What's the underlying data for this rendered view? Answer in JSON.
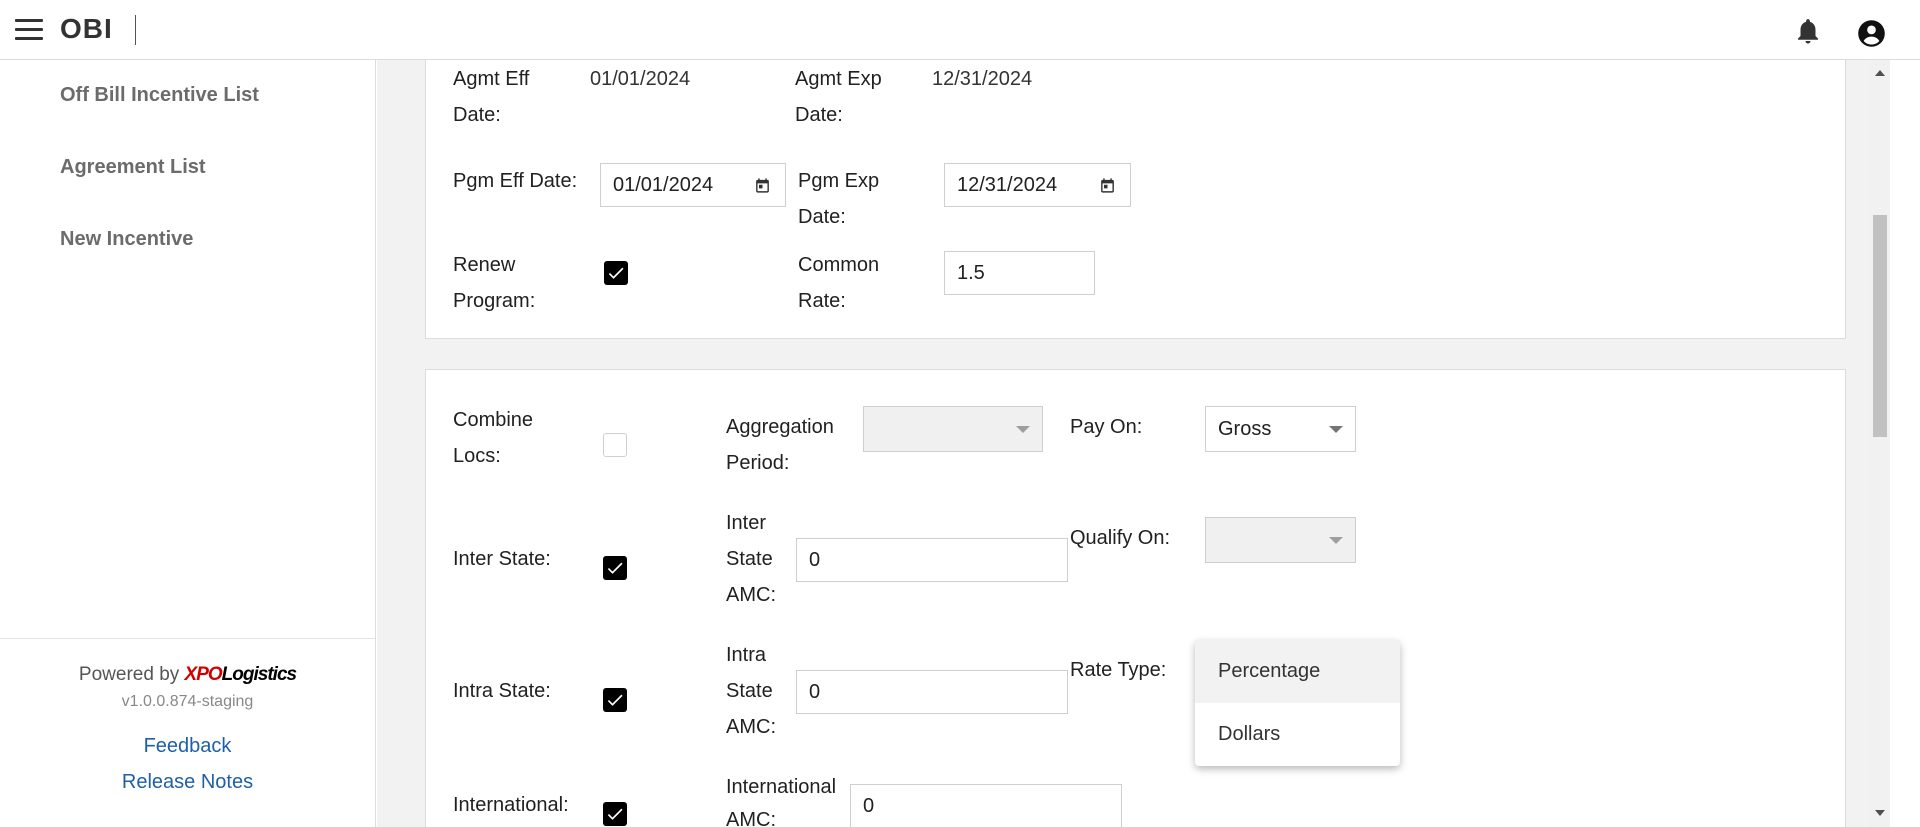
{
  "app": {
    "title": "OBI"
  },
  "icons": {
    "menu": "menu-icon",
    "bell": "bell-icon",
    "account": "account-circle-icon",
    "calendar": "calendar-icon",
    "check": "check-icon",
    "caret": "caret-down-icon"
  },
  "sidebar": {
    "items": [
      {
        "label": "Off Bill Incentive List"
      },
      {
        "label": "Agreement List"
      },
      {
        "label": "New Incentive"
      }
    ],
    "footer": {
      "powered_by": "Powered by",
      "brand_xpo": "XPO",
      "brand_logistics": "Logistics",
      "version": "v1.0.0.874-staging",
      "feedback": "Feedback",
      "release_notes": "Release Notes"
    }
  },
  "agreement": {
    "agmt_eff_label1": "Agmt Eff",
    "agmt_eff_label2": "Date:",
    "agmt_eff_value": "01/01/2024",
    "agmt_exp_label1": "Agmt Exp",
    "agmt_exp_label2": "Date:",
    "agmt_exp_value": "12/31/2024",
    "pgm_eff_label": "Pgm Eff Date:",
    "pgm_eff_value": "01/01/2024",
    "pgm_exp_label1": "Pgm Exp",
    "pgm_exp_label2": "Date:",
    "pgm_exp_value": "12/31/2024",
    "renew_label1": "Renew",
    "renew_label2": "Program:",
    "renew_checked": true,
    "common_rate_label1": "Common",
    "common_rate_label2": "Rate:",
    "common_rate_value": "1.5"
  },
  "settings": {
    "combine_locs_label1": "Combine",
    "combine_locs_label2": "Locs:",
    "combine_locs_checked": false,
    "aggregation_label1": "Aggregation",
    "aggregation_label2": "Period:",
    "aggregation_value": "",
    "pay_on_label": "Pay On:",
    "pay_on_value": "Gross",
    "inter_state_label": "Inter State:",
    "inter_state_checked": true,
    "inter_amc_label1": "Inter",
    "inter_amc_label2": "State",
    "inter_amc_label3": "AMC:",
    "inter_amc_value": "0",
    "qualify_on_label": "Qualify On:",
    "qualify_on_value": "",
    "intra_state_label": "Intra State:",
    "intra_state_checked": true,
    "intra_amc_label1": "Intra",
    "intra_amc_label2": "State",
    "intra_amc_label3": "AMC:",
    "intra_amc_value": "0",
    "rate_type_label": "Rate Type:",
    "international_label": "International:",
    "international_checked": true,
    "intl_amc_label1": "International",
    "intl_amc_label2": "AMC:",
    "intl_amc_value": "0"
  },
  "rate_type_dropdown": {
    "options": [
      {
        "label": "Percentage",
        "highlighted": true
      },
      {
        "label": "Dollars",
        "highlighted": false
      }
    ]
  }
}
